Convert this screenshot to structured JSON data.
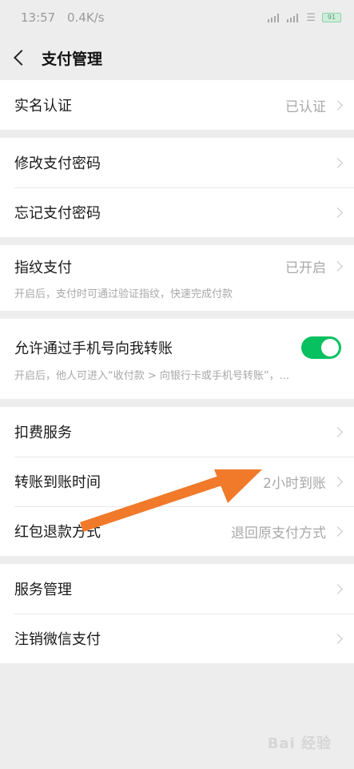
{
  "status_bar": {
    "time": "13:57",
    "speed": "0.4K/s",
    "battery": "91"
  },
  "nav": {
    "title": "支付管理"
  },
  "groups": {
    "realname": {
      "label": "实名认证",
      "value": "已认证"
    },
    "change_password": {
      "label": "修改支付密码"
    },
    "forgot_password": {
      "label": "忘记支付密码"
    },
    "fingerprint": {
      "label": "指纹支付",
      "value": "已开启",
      "desc": "开启后，支付时可通过验证指纹，快速完成付款"
    },
    "phone_transfer": {
      "label": "允许通过手机号向我转账",
      "enabled": true,
      "desc": "开启后，他人可进入“收付款 > 向银行卡或手机号转账”，..."
    },
    "deduction": {
      "label": "扣费服务"
    },
    "transfer_time": {
      "label": "转账到账时间",
      "value": "2小时到账"
    },
    "refund": {
      "label": "红包退款方式",
      "value": "退回原支付方式"
    },
    "service_mgmt": {
      "label": "服务管理"
    },
    "cancel_pay": {
      "label": "注销微信支付"
    }
  },
  "colors": {
    "accent": "#07c160",
    "arrow": "#f07a2a"
  },
  "watermark": "Bai 经验"
}
